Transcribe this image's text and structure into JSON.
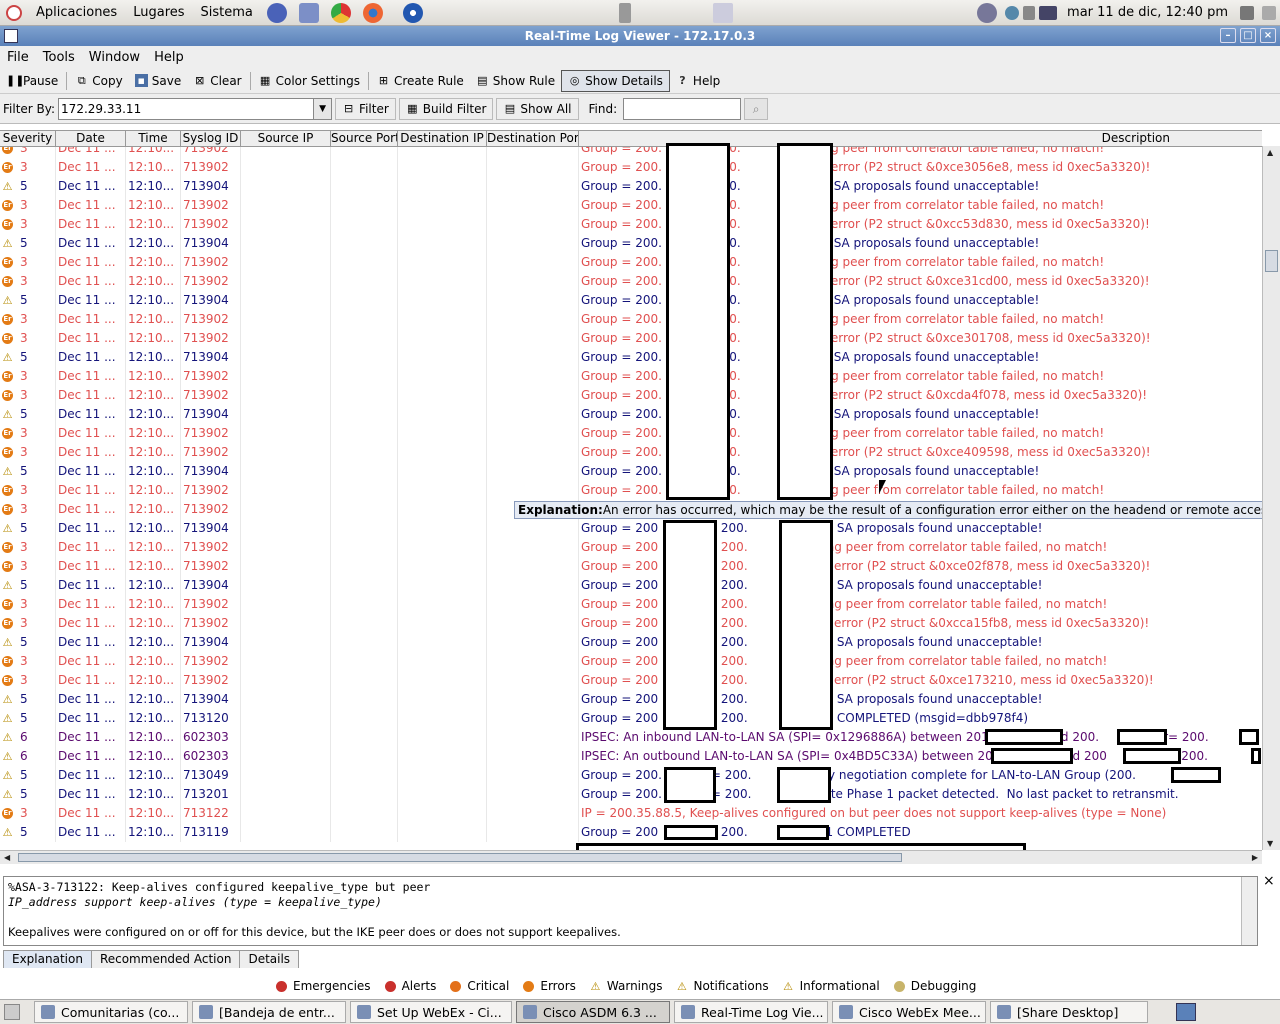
{
  "panel": {
    "apps": "Aplicaciones",
    "places": "Lugares",
    "system": "Sistema",
    "clock": "mar 11 de dic, 12:40 pm"
  },
  "window": {
    "title": "Real-Time Log Viewer - 172.17.0.3"
  },
  "menu": {
    "file": "File",
    "tools": "Tools",
    "window": "Window",
    "help": "Help"
  },
  "toolbar": {
    "pause": "Pause",
    "copy": "Copy",
    "save": "Save",
    "clear": "Clear",
    "color_settings": "Color Settings",
    "create_rule": "Create Rule",
    "show_rule": "Show Rule",
    "show_details": "Show Details",
    "help": "Help"
  },
  "filter": {
    "label": "Filter By:",
    "value": "172.29.33.11",
    "filter_btn": "Filter",
    "build_filter": "Build Filter",
    "show_all": "Show All",
    "find_label": "Find:"
  },
  "columns": {
    "severity": "Severity",
    "date": "Date",
    "time": "Time",
    "syslog_id": "Syslog ID",
    "source_ip": "Source IP",
    "source_port": "Source Port",
    "dest_ip": "Destination IP",
    "dest_port": "Destination Port",
    "description": "Description"
  },
  "rows": [
    {
      "sev": "3",
      "kind": "err",
      "date": "Dec 11 ...",
      "time": "12:10...",
      "id": "713902",
      "desc": "Group = 200.          = 200.          Removing peer from correlator table failed, no match!"
    },
    {
      "sev": "3",
      "kind": "err",
      "date": "Dec 11 ...",
      "time": "12:10...",
      "id": "713902",
      "desc": "Group = 200.          = 200.          QM FSM error (P2 struct &0xce3056e8, mess id 0xec5a3320)!"
    },
    {
      "sev": "5",
      "kind": "note",
      "date": "Dec 11 ...",
      "time": "12:10...",
      "id": "713904",
      "desc": "Group = 200.          = 200.          All IPSec SA proposals found unacceptable!"
    },
    {
      "sev": "3",
      "kind": "err",
      "date": "Dec 11 ...",
      "time": "12:10...",
      "id": "713902",
      "desc": "Group = 200.          = 200.          Removing peer from correlator table failed, no match!"
    },
    {
      "sev": "3",
      "kind": "err",
      "date": "Dec 11 ...",
      "time": "12:10...",
      "id": "713902",
      "desc": "Group = 200.          = 200.          QM FSM error (P2 struct &0xcc53d830, mess id 0xec5a3320)!"
    },
    {
      "sev": "5",
      "kind": "note",
      "date": "Dec 11 ...",
      "time": "12:10...",
      "id": "713904",
      "desc": "Group = 200.          = 200.          All IPSec SA proposals found unacceptable!"
    },
    {
      "sev": "3",
      "kind": "err",
      "date": "Dec 11 ...",
      "time": "12:10...",
      "id": "713902",
      "desc": "Group = 200.          = 200.          Removing peer from correlator table failed, no match!"
    },
    {
      "sev": "3",
      "kind": "err",
      "date": "Dec 11 ...",
      "time": "12:10...",
      "id": "713902",
      "desc": "Group = 200.          = 200.          QM FSM error (P2 struct &0xce31cd00, mess id 0xec5a3320)!"
    },
    {
      "sev": "5",
      "kind": "note",
      "date": "Dec 11 ...",
      "time": "12:10...",
      "id": "713904",
      "desc": "Group = 200.          = 200.          All IPSec SA proposals found unacceptable!"
    },
    {
      "sev": "3",
      "kind": "err",
      "date": "Dec 11 ...",
      "time": "12:10...",
      "id": "713902",
      "desc": "Group = 200.          = 200.          Removing peer from correlator table failed, no match!"
    },
    {
      "sev": "3",
      "kind": "err",
      "date": "Dec 11 ...",
      "time": "12:10...",
      "id": "713902",
      "desc": "Group = 200.          = 200.          QM FSM error (P2 struct &0xce301708, mess id 0xec5a3320)!"
    },
    {
      "sev": "5",
      "kind": "note",
      "date": "Dec 11 ...",
      "time": "12:10...",
      "id": "713904",
      "desc": "Group = 200.          = 200.          All IPSec SA proposals found unacceptable!"
    },
    {
      "sev": "3",
      "kind": "err",
      "date": "Dec 11 ...",
      "time": "12:10...",
      "id": "713902",
      "desc": "Group = 200.          = 200.          Removing peer from correlator table failed, no match!"
    },
    {
      "sev": "3",
      "kind": "err",
      "date": "Dec 11 ...",
      "time": "12:10...",
      "id": "713902",
      "desc": "Group = 200.          = 200.          QM FSM error (P2 struct &0xcda4f078, mess id 0xec5a3320)!"
    },
    {
      "sev": "5",
      "kind": "note",
      "date": "Dec 11 ...",
      "time": "12:10...",
      "id": "713904",
      "desc": "Group = 200.          = 200.          All IPSec SA proposals found unacceptable!"
    },
    {
      "sev": "3",
      "kind": "err",
      "date": "Dec 11 ...",
      "time": "12:10...",
      "id": "713902",
      "desc": "Group = 200.          = 200.          Removing peer from correlator table failed, no match!"
    },
    {
      "sev": "3",
      "kind": "err",
      "date": "Dec 11 ...",
      "time": "12:10...",
      "id": "713902",
      "desc": "Group = 200.          = 200.          QM FSM error (P2 struct &0xce409598, mess id 0xec5a3320)!"
    },
    {
      "sev": "5",
      "kind": "note",
      "date": "Dec 11 ...",
      "time": "12:10...",
      "id": "713904",
      "desc": "Group = 200.          = 200.          All IPSec SA proposals found unacceptable!"
    },
    {
      "sev": "3",
      "kind": "err",
      "date": "Dec 11 ...",
      "time": "12:10...",
      "id": "713902",
      "desc": "Group = 200.          = 200.          Removing peer from correlator table failed, no match!"
    },
    {
      "sev": "3",
      "kind": "err",
      "date": "Dec 11 ...",
      "time": "12:10...",
      "id": "713902",
      "desc": ""
    },
    {
      "sev": "5",
      "kind": "note",
      "date": "Dec 11 ...",
      "time": "12:10...",
      "id": "713904",
      "desc": "Group = 200         IP = 200.         All IPSec SA proposals found unacceptable!"
    },
    {
      "sev": "3",
      "kind": "err",
      "date": "Dec 11 ...",
      "time": "12:10...",
      "id": "713902",
      "desc": "Group = 200         IP = 200.         Removing peer from correlator table failed, no match!"
    },
    {
      "sev": "3",
      "kind": "err",
      "date": "Dec 11 ...",
      "time": "12:10...",
      "id": "713902",
      "desc": "Group = 200         IP = 200.         QM FSM error (P2 struct &0xce02f878, mess id 0xec5a3320)!"
    },
    {
      "sev": "5",
      "kind": "note",
      "date": "Dec 11 ...",
      "time": "12:10...",
      "id": "713904",
      "desc": "Group = 200         IP = 200.         All IPSec SA proposals found unacceptable!"
    },
    {
      "sev": "3",
      "kind": "err",
      "date": "Dec 11 ...",
      "time": "12:10...",
      "id": "713902",
      "desc": "Group = 200         IP = 200.         Removing peer from correlator table failed, no match!"
    },
    {
      "sev": "3",
      "kind": "err",
      "date": "Dec 11 ...",
      "time": "12:10...",
      "id": "713902",
      "desc": "Group = 200         IP = 200.         QM FSM error (P2 struct &0xcca15fb8, mess id 0xec5a3320)!"
    },
    {
      "sev": "5",
      "kind": "note",
      "date": "Dec 11 ...",
      "time": "12:10...",
      "id": "713904",
      "desc": "Group = 200         IP = 200.         All IPSec SA proposals found unacceptable!"
    },
    {
      "sev": "3",
      "kind": "err",
      "date": "Dec 11 ...",
      "time": "12:10...",
      "id": "713902",
      "desc": "Group = 200         IP = 200.         Removing peer from correlator table failed, no match!"
    },
    {
      "sev": "3",
      "kind": "err",
      "date": "Dec 11 ...",
      "time": "12:10...",
      "id": "713902",
      "desc": "Group = 200         IP = 200.         QM FSM error (P2 struct &0xce173210, mess id 0xec5a3320)!"
    },
    {
      "sev": "5",
      "kind": "note",
      "date": "Dec 11 ...",
      "time": "12:10...",
      "id": "713904",
      "desc": "Group = 200         IP = 200.         All IPSec SA proposals found unacceptable!"
    },
    {
      "sev": "5",
      "kind": "note",
      "date": "Dec 11 ...",
      "time": "12:10...",
      "id": "713120",
      "desc": "Group = 200         IP = 200.         PHASE 2 COMPLETED (msgid=dbb978f4)"
    },
    {
      "sev": "6",
      "kind": "info",
      "date": "Dec 11 ...",
      "time": "12:10...",
      "id": "602303",
      "desc": "IPSEC: An inbound LAN-to-LAN SA (SPI= 0x1296886A) between 201.              and 200.          (user= 200."
    },
    {
      "sev": "6",
      "kind": "info",
      "date": "Dec 11 ...",
      "time": "12:10...",
      "id": "602303",
      "desc": "IPSEC: An outbound LAN-to-LAN SA (SPI= 0x4BD5C33A) between 201.              and 200         user= 200."
    },
    {
      "sev": "5",
      "kind": "note",
      "date": "Dec 11 ...",
      "time": "12:10...",
      "id": "713049",
      "desc": "Group = 200.         IP = 200.         Security negotiation complete for LAN-to-LAN Group (200.          )  Initiat"
    },
    {
      "sev": "5",
      "kind": "note",
      "date": "Dec 11 ...",
      "time": "12:10...",
      "id": "713201",
      "desc": "Group = 200.         IP = 200.         Duplicate Phase 1 packet detected.  No last packet to retransmit."
    },
    {
      "sev": "3",
      "kind": "err",
      "date": "Dec 11 ...",
      "time": "12:10...",
      "id": "713122",
      "desc": "IP = 200.35.88.5, Keep-alives configured on but peer does not support keep-alives (type = None)"
    },
    {
      "sev": "5",
      "kind": "note",
      "date": "Dec 11 ...",
      "time": "12:10...",
      "id": "713119",
      "desc": "Group = 200         IP = 200.         PHASE 1 COMPLETED"
    }
  ],
  "tooltip": {
    "label": "Explanation:",
    "text": "An error has occurred, which may be the result of a configuration error either on the headend or remote access client."
  },
  "explanation": {
    "line1": "%ASA-3-713122: Keep-alives configured keepalive_type but peer",
    "line2": "IP_address support keep-alives (type = keepalive_type)",
    "line3": "Keepalives were configured on or off for this device, but the IKE peer does or does not support keepalives."
  },
  "detail_tabs": {
    "explanation": "Explanation",
    "recommended": "Recommended Action",
    "details": "Details"
  },
  "legend": {
    "emergencies": "Emergencies",
    "alerts": "Alerts",
    "critical": "Critical",
    "errors": "Errors",
    "warnings": "Warnings",
    "notifications": "Notifications",
    "informational": "Informational",
    "debugging": "Debugging"
  },
  "taskbar": [
    {
      "label": "Comunitarias (co...",
      "active": false
    },
    {
      "label": "[Bandeja de entr...",
      "active": false
    },
    {
      "label": "Set Up WebEx - Ci...",
      "active": false
    },
    {
      "label": "Cisco ASDM 6.3 ...",
      "active": true
    },
    {
      "label": "Real-Time Log Vie...",
      "active": false
    },
    {
      "label": "Cisco WebEx Mee...",
      "active": false
    },
    {
      "label": "[Share Desktop]",
      "active": false
    }
  ],
  "colors": {
    "error": "#e05050",
    "notification": "#14147a",
    "info": "#5a0a6e",
    "titlebar": "#5a81b9"
  }
}
